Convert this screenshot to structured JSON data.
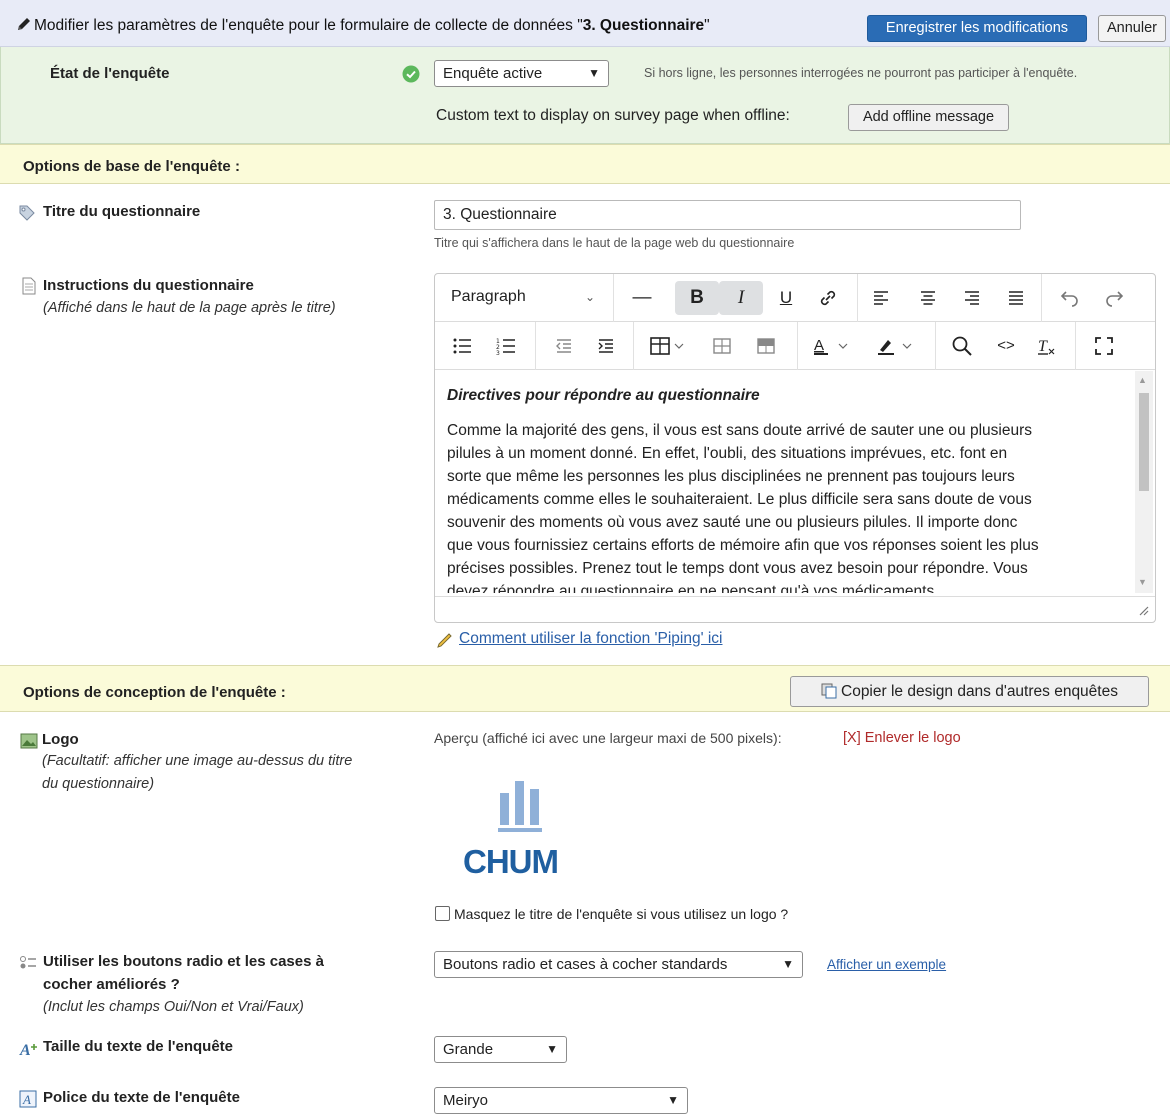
{
  "header": {
    "title_prefix": "Modifier les paramètres de l'enquête pour le formulaire de collecte de données \"",
    "title_name": "3. Questionnaire",
    "title_suffix": "\"",
    "save_label": "Enregistrer les modifications",
    "cancel_label": "Annuler"
  },
  "status": {
    "label": "État de l'enquête",
    "selected": "Enquête active",
    "hint": "Si hors ligne, les personnes interrogées ne pourront pas participer à l'enquête.",
    "offline_text": "Custom text to display on survey page when offline:",
    "offline_button": "Add offline message"
  },
  "basic": {
    "section_title": "Options de base de l'enquête :",
    "title_label": "Titre du questionnaire",
    "title_value": "3. Questionnaire",
    "title_hint": "Titre qui s'affichera dans le haut de la page web du questionnaire",
    "instructions_label": "Instructions du questionnaire",
    "instructions_sub": "(Affiché dans le haut de la page après le titre)"
  },
  "editor": {
    "paragraph_label": "Paragraph",
    "heading": "Directives pour répondre au questionnaire",
    "lines": [
      "Comme la majorité des gens, il vous est sans doute arrivé de sauter une ou plusieurs",
      "pilules à un moment donné. En effet, l'oubli, des situations imprévues, etc. font en",
      "sorte que même les personnes les plus disciplinées ne prennent pas toujours leurs",
      "médicaments comme elles le souhaiteraient. Le plus difficile sera sans doute de vous",
      "souvenir des moments où vous avez sauté une ou plusieurs pilules. Il importe donc",
      "que vous fournissiez certains efforts de mémoire afin que vos réponses soient les plus",
      "précises possibles. Prenez tout le temps dont vous avez besoin pour répondre. Vous",
      "devez répondre au questionnaire en ne pensant qu'à vos médicaments"
    ]
  },
  "piping_link": "Comment utiliser la fonction 'Piping' ici",
  "design": {
    "section_title": "Options de conception de l'enquête :",
    "copy_button": "Copier le design dans d'autres enquêtes",
    "logo_label": "Logo",
    "logo_sub_1": "(Facultatif: afficher une image au-dessus du titre",
    "logo_sub_2": "du questionnaire)",
    "preview_text": "Aperçu (affiché ici avec une largeur maxi de 500 pixels):",
    "remove_logo": "[X] Enlever le logo",
    "logo_word": "CHUM",
    "hide_title_label": "Masquez le titre de l'enquête si vous utilisez un logo ?",
    "radio_label_1": "Utiliser les boutons radio et les cases à",
    "radio_label_2": "cocher améliorés ?",
    "radio_sub": "(Inclut les champs Oui/Non et Vrai/Faux)",
    "radio_selected": "Boutons radio et cases à cocher standards",
    "show_example": "Afficher un exemple",
    "text_size_label": "Taille du texte de l'enquête",
    "text_size_selected": "Grande",
    "font_label": "Police du texte de l'enquête",
    "font_selected": "Meiryo"
  },
  "colors": {
    "header_bg": "#e8ebf7",
    "primary_button": "#2a6cb5",
    "status_bg": "#eaf4e4",
    "section_bg": "#fbfbd9",
    "link": "#2a5fa8",
    "remove_link": "#b02a2a",
    "logo_blue": "#1f5fa0",
    "logo_light": "#8fb0d8"
  }
}
